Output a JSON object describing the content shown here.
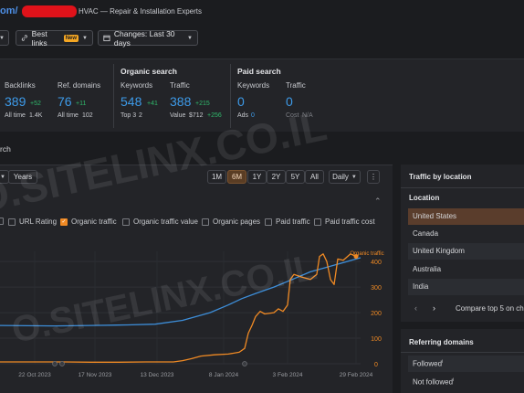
{
  "header": {
    "url_fragment": "om/",
    "site_description": "HVAC — Repair & Installation Experts"
  },
  "toolbar": {
    "best_links_label": "Best links",
    "new_badge": "New",
    "changes_label": "Changes: Last 30 days"
  },
  "metrics": {
    "backlinks": {
      "label": "Backlinks",
      "value": "389",
      "delta": "+52",
      "sub_label": "All time",
      "sub_value": "1.4K"
    },
    "ref_domains": {
      "label": "Ref. domains",
      "value": "76",
      "delta": "+11",
      "sub_label": "All time",
      "sub_value": "102"
    },
    "organic_heading": "Organic search",
    "org_keywords": {
      "label": "Keywords",
      "value": "548",
      "delta": "+41",
      "sub_label": "Top 3",
      "sub_value": "2"
    },
    "org_traffic": {
      "label": "Traffic",
      "value": "388",
      "delta": "+215",
      "sub_label": "Value",
      "sub_value": "$712",
      "sub_delta": "+256"
    },
    "paid_heading": "Paid search",
    "paid_keywords": {
      "label": "Keywords",
      "value": "0",
      "sub_label": "Ads",
      "sub_value": "0"
    },
    "paid_traffic": {
      "label": "Traffic",
      "value": "0",
      "sub_label": "Cost",
      "sub_value": "N/A"
    }
  },
  "section_tab_label": "rch",
  "chart_controls": {
    "years_label": "Years",
    "ranges": [
      "1M",
      "6M",
      "1Y",
      "2Y",
      "5Y",
      "All"
    ],
    "active_range": "6M",
    "interval_label": "Daily",
    "more_label": "⋮"
  },
  "legend": [
    {
      "label": "URL Rating",
      "checked": false
    },
    {
      "label": "Organic traffic",
      "checked": true
    },
    {
      "label": "Organic traffic value",
      "checked": false
    },
    {
      "label": "Organic pages",
      "checked": false
    },
    {
      "label": "Paid traffic",
      "checked": false
    },
    {
      "label": "Paid traffic cost",
      "checked": false
    }
  ],
  "chart_data": {
    "type": "line",
    "series_label": "Organic traffic",
    "y_ticks": [
      "400",
      "300",
      "200",
      "100",
      "0"
    ],
    "x_tick_labels": [
      "22 Oct 2023",
      "17 Nov 2023",
      "13 Dec 2023",
      "8 Jan 2024",
      "3 Feb 2024",
      "29 Feb 2024"
    ],
    "ylim": [
      0,
      440
    ],
    "series": [
      {
        "name": "Organic traffic",
        "color": "#f08a24",
        "values": [
          [
            0,
            7
          ],
          [
            40,
            7
          ],
          [
            70,
            7
          ],
          [
            100,
            6
          ],
          [
            130,
            6
          ],
          [
            160,
            7
          ],
          [
            190,
            7
          ],
          [
            200,
            12
          ],
          [
            210,
            20
          ],
          [
            220,
            30
          ],
          [
            235,
            35
          ],
          [
            250,
            38
          ],
          [
            262,
            45
          ],
          [
            268,
            60
          ],
          [
            272,
            120
          ],
          [
            276,
            150
          ],
          [
            280,
            185
          ],
          [
            285,
            205
          ],
          [
            290,
            195
          ],
          [
            300,
            200
          ],
          [
            305,
            215
          ],
          [
            310,
            205
          ],
          [
            315,
            230
          ],
          [
            318,
            330
          ],
          [
            322,
            350
          ],
          [
            330,
            340
          ],
          [
            340,
            330
          ],
          [
            347,
            350
          ],
          [
            350,
            420
          ],
          [
            354,
            430
          ],
          [
            358,
            400
          ],
          [
            362,
            330
          ],
          [
            366,
            310
          ],
          [
            370,
            410
          ],
          [
            376,
            405
          ],
          [
            384,
            430
          ],
          [
            390,
            420
          ]
        ]
      },
      {
        "name": "Comparison line",
        "color": "#3d8ed9",
        "values": [
          [
            0,
            150
          ],
          [
            60,
            148
          ],
          [
            100,
            150
          ],
          [
            140,
            152
          ],
          [
            170,
            155
          ],
          [
            200,
            170
          ],
          [
            230,
            200
          ],
          [
            250,
            230
          ],
          [
            265,
            255
          ],
          [
            280,
            275
          ],
          [
            300,
            300
          ],
          [
            320,
            330
          ],
          [
            340,
            360
          ],
          [
            355,
            375
          ],
          [
            370,
            390
          ],
          [
            385,
            405
          ],
          [
            395,
            415
          ]
        ]
      }
    ]
  },
  "traffic_by_location": {
    "title": "Traffic by location",
    "column": "Location",
    "rows": [
      "United States",
      "Canada",
      "United Kingdom",
      "Australia",
      "India"
    ],
    "compare_label": "Compare top 5 on cha"
  },
  "referring_domains": {
    "title": "Referring domains",
    "rows": [
      "Followed",
      "Not followed"
    ]
  },
  "watermark": "O.SITELINX.CO.IL"
}
